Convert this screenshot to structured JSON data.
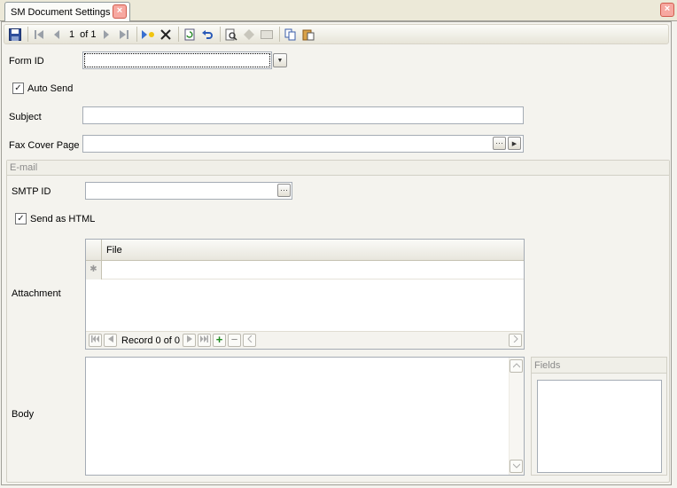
{
  "tab": {
    "title": "SM Document Settings",
    "close": "×"
  },
  "window": {
    "close": "×"
  },
  "toolbar": {
    "record_current": "1",
    "record_total": "of 1"
  },
  "form": {
    "form_id": {
      "label": "Form ID",
      "value": ""
    },
    "auto_send": {
      "label": "Auto Send",
      "checked": true
    },
    "subject": {
      "label": "Subject",
      "value": ""
    },
    "fax_cover": {
      "label": "Fax Cover Page",
      "value": ""
    }
  },
  "email": {
    "group_title": "E-mail",
    "smtp_id": {
      "label": "SMTP ID",
      "value": ""
    },
    "send_html": {
      "label": "Send as HTML",
      "checked": true
    },
    "attachment": {
      "label": "Attachment",
      "columns": [
        "File"
      ],
      "rows": [],
      "record_text": "Record 0 of 0"
    },
    "body": {
      "label": "Body",
      "value": ""
    },
    "fields": {
      "title": "Fields",
      "items": []
    }
  },
  "glyphs": {
    "check": "✓",
    "ellipsis": "···",
    "arrow_right": "▶",
    "arrow_down": "▼",
    "new_row": "✱",
    "plus": "+",
    "minus": "−"
  }
}
